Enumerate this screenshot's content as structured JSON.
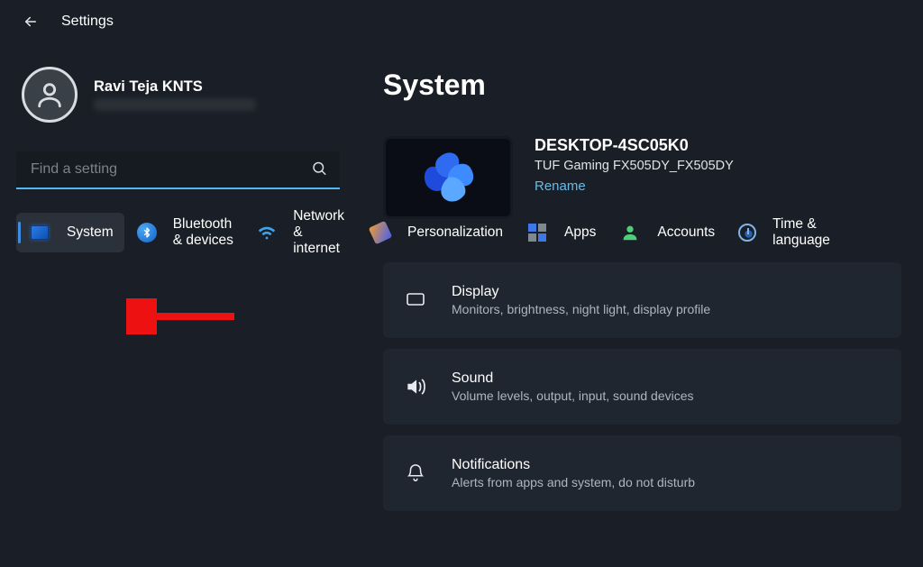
{
  "header": {
    "title": "Settings"
  },
  "user": {
    "name": "Ravi Teja KNTS"
  },
  "search": {
    "placeholder": "Find a setting"
  },
  "sidebar": {
    "items": [
      {
        "label": "System"
      },
      {
        "label": "Bluetooth & devices"
      },
      {
        "label": "Network & internet"
      },
      {
        "label": "Personalization"
      },
      {
        "label": "Apps"
      },
      {
        "label": "Accounts"
      },
      {
        "label": "Time & language"
      }
    ]
  },
  "main": {
    "title": "System",
    "device": {
      "name": "DESKTOP-4SC05K0",
      "model": "TUF Gaming FX505DY_FX505DY",
      "rename": "Rename"
    },
    "cards": [
      {
        "title": "Display",
        "sub": "Monitors, brightness, night light, display profile"
      },
      {
        "title": "Sound",
        "sub": "Volume levels, output, input, sound devices"
      },
      {
        "title": "Notifications",
        "sub": "Alerts from apps and system, do not disturb"
      }
    ]
  }
}
